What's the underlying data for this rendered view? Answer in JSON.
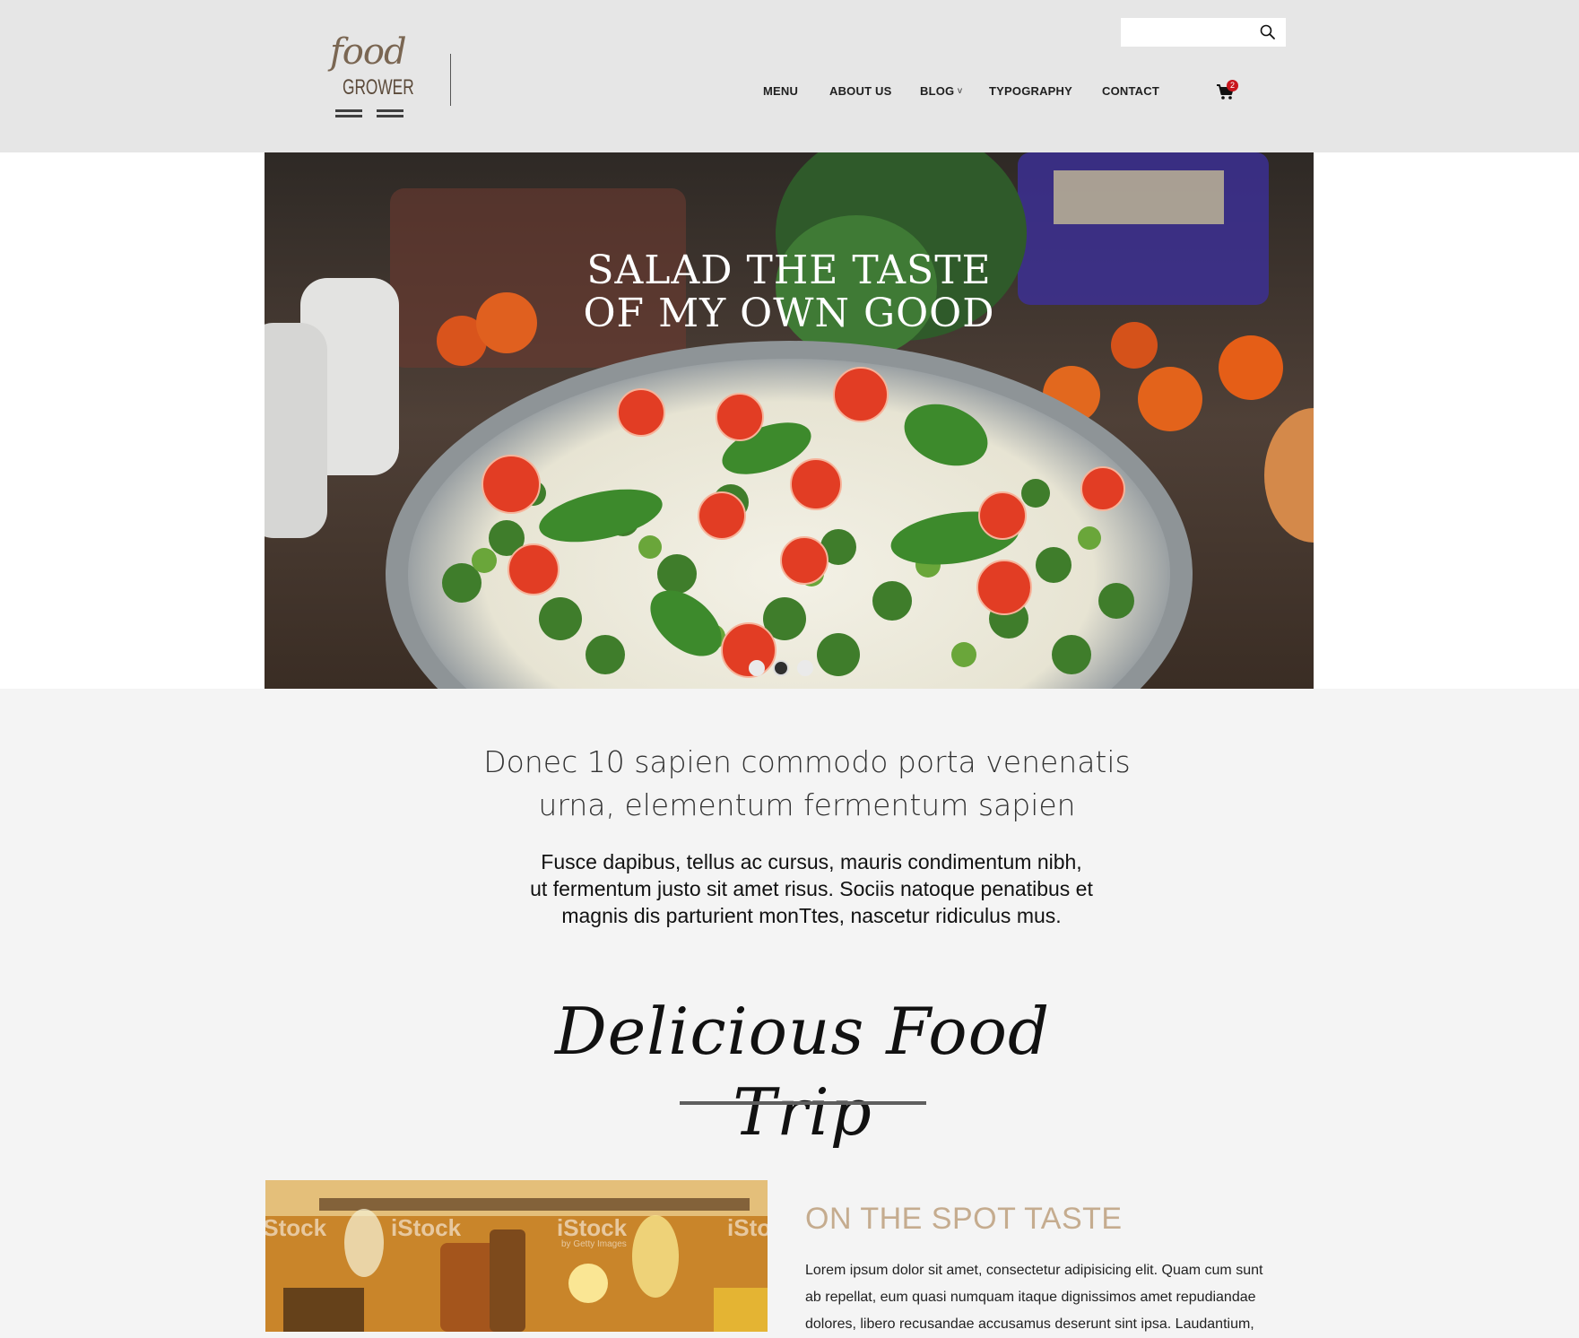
{
  "brand": {
    "logo_word_top": "food",
    "logo_word_bottom": "GROWER",
    "logo_color": "#7a6652"
  },
  "search": {
    "placeholder": "",
    "value": "",
    "icon": "search-icon"
  },
  "nav": {
    "items": [
      {
        "label": "MENU"
      },
      {
        "label": "ABOUT US"
      },
      {
        "label": "BLOG",
        "has_dropdown": true
      },
      {
        "label": "TYPOGRAPHY"
      },
      {
        "label": "CONTACT"
      }
    ],
    "dropdown_glyph": "v",
    "cart": {
      "icon": "cart-icon",
      "count": "2",
      "badge_color": "#c8161d"
    }
  },
  "hero": {
    "title_line1": "SALAD THE TASTE",
    "title_line2": "OF MY OWN GOOD",
    "slides": {
      "count": 3,
      "active_index": 1
    }
  },
  "intro": {
    "heading_line1": "Donec 10 sapien commodo porta venenatis",
    "heading_line2": "urna, elementum fermentum sapien",
    "text_line1": "Fusce dapibus, tellus ac cursus, mauris condimentum nibh,",
    "text_line2": "ut fermentum justo sit amet risus. Sociis natoque penatibus et",
    "text_line3": "magnis dis parturient monTtes, nascetur ridiculus mus."
  },
  "section": {
    "title": "Delicious Food Trip"
  },
  "feature": {
    "image_watermark": "iStock",
    "image_watermark_sub": "by Getty Images",
    "title": "ON THE SPOT TASTE",
    "title_color": "#c5ac8f",
    "body_line1": "Lorem ipsum dolor sit amet, consectetur adipisicing elit. Quam cum sunt",
    "body_line2": "ab repellat, eum quasi numquam itaque dignissimos amet repudiandae",
    "body_line3": "dolores, libero recusandae accusamus deserunt sint ipsa. Laudantium,"
  }
}
